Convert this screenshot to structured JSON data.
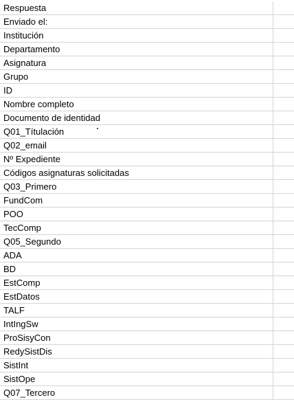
{
  "sheet": {
    "column_a_cells": [
      "Respuesta",
      "Enviado el:",
      "Institución",
      "Departamento",
      "Asignatura",
      "Grupo",
      "ID",
      "Nombre completo",
      "Documento de identidad",
      "Q01_Títulación",
      "Q02_email",
      "Nº Expediente",
      "Códigos asignaturas solicitadas",
      "Q03_Primero",
      "FundCom",
      "POO",
      "TecComp",
      "Q05_Segundo",
      "ADA",
      "BD",
      "EstComp",
      "EstDatos",
      "TALF",
      "IntIngSw",
      "ProSisyCon",
      "RedySistDis",
      "SistInt",
      "SistOpe",
      "Q07_Tercero"
    ]
  },
  "colors": {
    "gridline": "#d4d4d4",
    "text": "#000000",
    "background": "#ffffff"
  }
}
